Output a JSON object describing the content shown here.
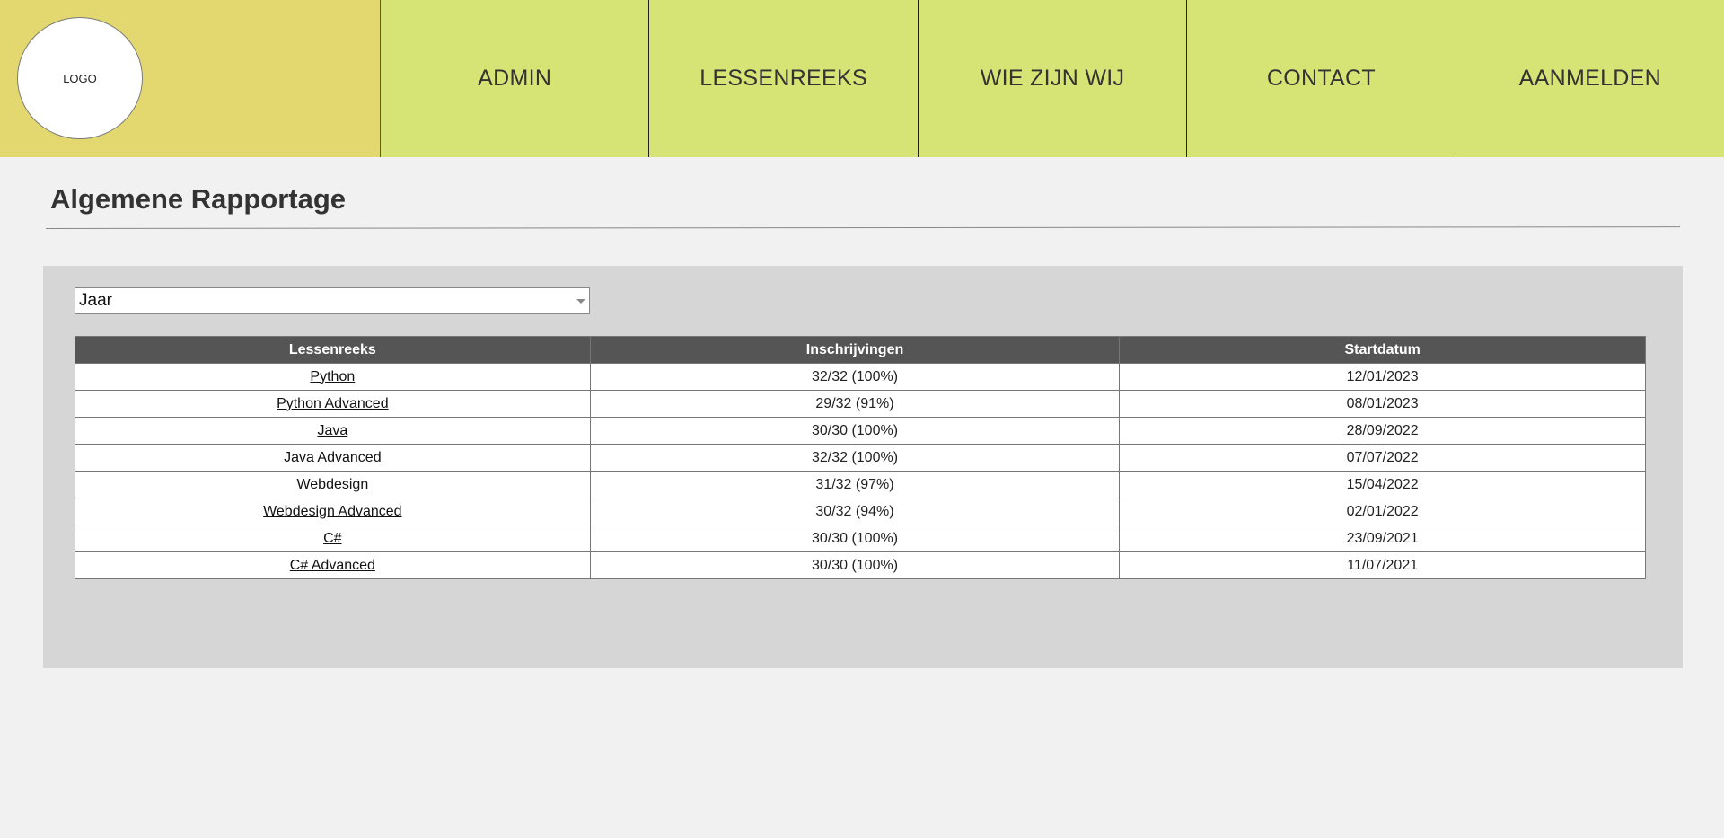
{
  "header": {
    "logo_text": "LOGO",
    "nav": [
      "ADMIN",
      "LESSENREEKS",
      "WIE ZIJN WIJ",
      "CONTACT",
      "AANMELDEN"
    ]
  },
  "main": {
    "title": "Algemene Rapportage",
    "filter": {
      "selected": "Jaar"
    },
    "table": {
      "columns": [
        "Lessenreeks",
        "Inschrijvingen",
        "Startdatum"
      ],
      "rows": [
        [
          "Python",
          "32/32 (100%)",
          "12/01/2023"
        ],
        [
          "Python Advanced",
          "29/32 (91%)",
          "08/01/2023"
        ],
        [
          "Java",
          "30/30 (100%)",
          "28/09/2022"
        ],
        [
          "Java Advanced",
          "32/32 (100%)",
          "07/07/2022"
        ],
        [
          "Webdesign",
          "31/32 (97%)",
          "15/04/2022"
        ],
        [
          "Webdesign Advanced",
          "30/32 (94%)",
          "02/01/2022"
        ],
        [
          "C#",
          "30/30 (100%)",
          "23/09/2021"
        ],
        [
          "C# Advanced",
          "30/30 (100%)",
          "11/07/2021"
        ]
      ]
    }
  },
  "colors": {
    "logo_bg": "#e3d86f",
    "nav_bg": "#d5e475",
    "page_bg": "#f1f1f1",
    "panel_bg": "#d6d6d6",
    "table_header_bg": "#555555"
  },
  "icons": {
    "select_arrow": "chevron-down-icon"
  }
}
